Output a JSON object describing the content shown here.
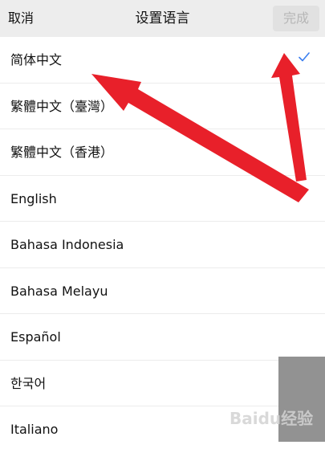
{
  "header": {
    "cancel": "取消",
    "title": "设置语言",
    "done": "完成"
  },
  "languages": [
    {
      "label": "简体中文",
      "selected": true
    },
    {
      "label": "繁體中文（臺灣）",
      "selected": false
    },
    {
      "label": "繁體中文（香港）",
      "selected": false
    },
    {
      "label": "English",
      "selected": false
    },
    {
      "label": "Bahasa Indonesia",
      "selected": false
    },
    {
      "label": "Bahasa Melayu",
      "selected": false
    },
    {
      "label": "Español",
      "selected": false
    },
    {
      "label": "한국어",
      "selected": false
    },
    {
      "label": "Italiano",
      "selected": false
    }
  ],
  "watermark": "Baidu经验",
  "colors": {
    "check": "#3b7ff0",
    "arrow": "#e8202a",
    "navbar_bg": "#ededed"
  },
  "icons": {
    "check": "check-icon"
  }
}
